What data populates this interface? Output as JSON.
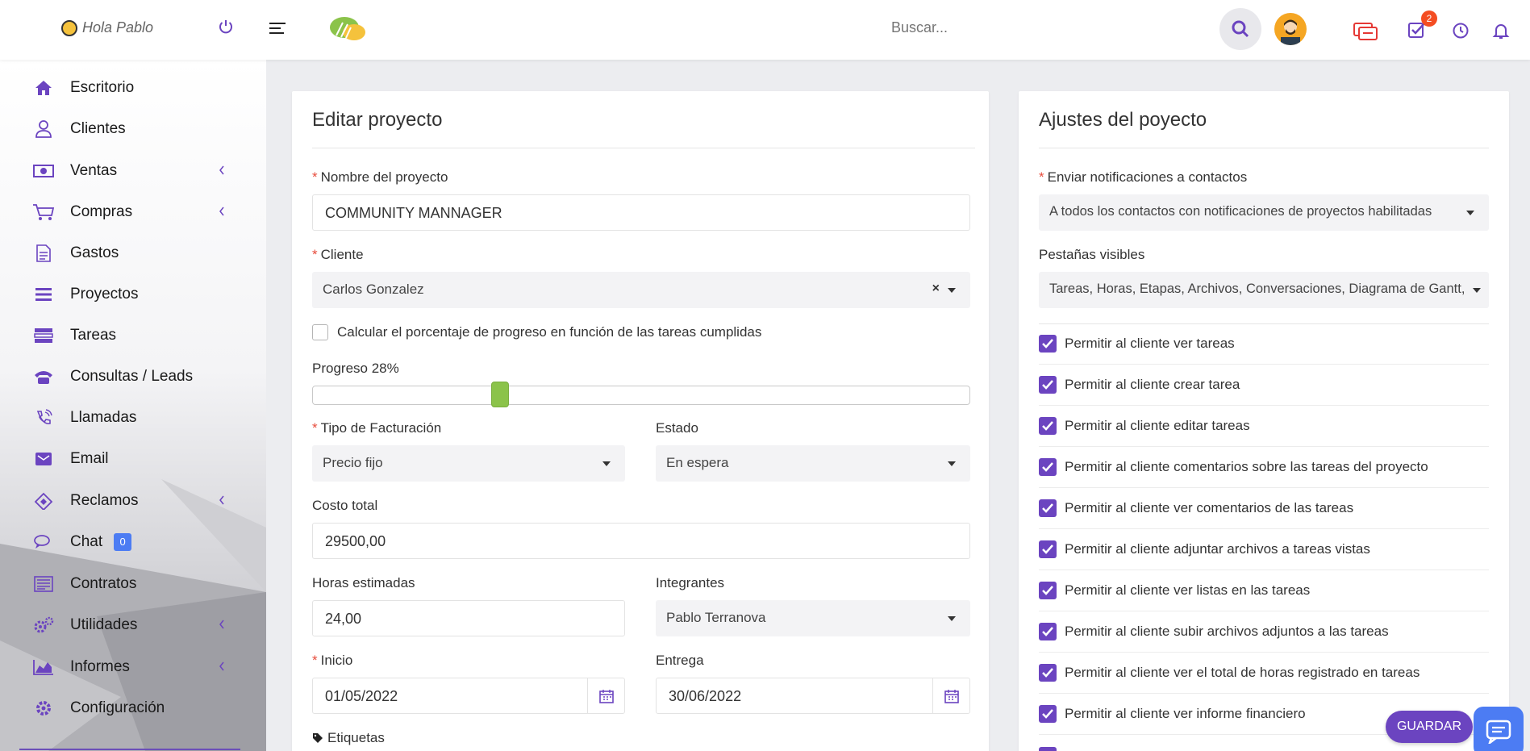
{
  "header": {
    "greeting": "Hola Pablo",
    "search_placeholder": "Buscar...",
    "tasks_badge": "2"
  },
  "sidebar": {
    "items": [
      {
        "label": "Escritorio",
        "icon": "home-icon"
      },
      {
        "label": "Clientes",
        "icon": "user-icon"
      },
      {
        "label": "Ventas",
        "icon": "money-icon",
        "has_submenu": true
      },
      {
        "label": "Compras",
        "icon": "cart-icon",
        "has_submenu": true
      },
      {
        "label": "Gastos",
        "icon": "file-icon"
      },
      {
        "label": "Proyectos",
        "icon": "bars-icon"
      },
      {
        "label": "Tareas",
        "icon": "tasks-icon"
      },
      {
        "label": "Consultas / Leads",
        "icon": "phone-icon"
      },
      {
        "label": "Llamadas",
        "icon": "phone-volume-icon"
      },
      {
        "label": "Email",
        "icon": "envelope-icon"
      },
      {
        "label": "Reclamos",
        "icon": "ticket-icon",
        "has_submenu": true
      },
      {
        "label": "Chat",
        "icon": "comments-icon",
        "badge": "0"
      },
      {
        "label": "Contratos",
        "icon": "contract-icon"
      },
      {
        "label": "Utilidades",
        "icon": "cogs-icon",
        "has_submenu": true
      },
      {
        "label": "Informes",
        "icon": "area-chart-icon",
        "has_submenu": true
      },
      {
        "label": "Configuración",
        "icon": "gear-icon"
      }
    ]
  },
  "edit_project": {
    "title": "Editar proyecto",
    "name_label": "Nombre del proyecto",
    "name_value": "COMMUNITY MANNAGER",
    "client_label": "Cliente",
    "client_value": "Carlos Gonzalez",
    "calc_progress_label": "Calcular el porcentaje de progreso en función de las tareas cumplidas",
    "progress_label": "Progreso 28%",
    "progress_value": 0.28,
    "billing_label": "Tipo de Facturación",
    "billing_value": "Precio fijo",
    "status_label": "Estado",
    "status_value": "En espera",
    "cost_label": "Costo total",
    "cost_value": "29500,00",
    "hours_label": "Horas estimadas",
    "hours_value": "24,00",
    "members_label": "Integrantes",
    "members_value": "Pablo Terranova",
    "start_label": "Inicio",
    "start_value": "01/05/2022",
    "deadline_label": "Entrega",
    "deadline_value": "30/06/2022",
    "tags_label": "Etiquetas"
  },
  "settings": {
    "title": "Ajustes del poyecto",
    "notify_label": "Enviar notificaciones a contactos",
    "notify_value": "A todos los contactos con notificaciones de proyectos habilitadas",
    "tabs_label": "Pestañas visibles",
    "tabs_value": "Tareas, Horas, Etapas, Archivos, Conversaciones, Diagrama de Gantt,",
    "permissions": [
      "Permitir al cliente ver tareas",
      "Permitir al cliente crear tarea",
      "Permitir al cliente editar tareas",
      "Permitir al cliente comentarios sobre las tareas del proyecto",
      "Permitir al cliente ver comentarios de las tareas",
      "Permitir al cliente adjuntar archivos a tareas vistas",
      "Permitir al cliente ver listas en las tareas",
      "Permitir al cliente subir archivos adjuntos a las tareas",
      "Permitir al cliente ver el total de horas registrado en tareas",
      "Permitir al cliente ver informe financiero"
    ]
  },
  "actions": {
    "save_label": "GUARDAR"
  },
  "colors": {
    "accent": "#6b44c0",
    "slider": "#8bc34a",
    "badge": "#f44d22",
    "chat_badge": "#4c7cf3"
  }
}
